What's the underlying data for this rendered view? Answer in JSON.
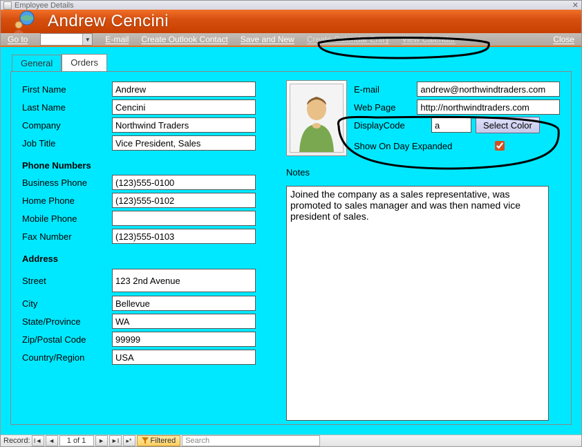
{
  "window": {
    "title": "Employee Details",
    "close_glyph": "✕"
  },
  "header": {
    "full_name": "Andrew Cencini"
  },
  "toolbar": {
    "goto_label": "Go to",
    "email": "E-mail",
    "create_outlook": "Create Outlook Contact",
    "save_new": "Save and New",
    "create_cal": "Create Calendar Entry",
    "view_cal": "View Calendar",
    "close": "Close"
  },
  "tabs": {
    "general": "General",
    "orders": "Orders"
  },
  "fields": {
    "first_name_lbl": "First Name",
    "first_name": "Andrew",
    "last_name_lbl": "Last Name",
    "last_name": "Cencini",
    "company_lbl": "Company",
    "company": "Northwind Traders",
    "job_title_lbl": "Job Title",
    "job_title": "Vice President, Sales",
    "phone_section": "Phone Numbers",
    "bus_phone_lbl": "Business Phone",
    "bus_phone": "(123)555-0100",
    "home_phone_lbl": "Home Phone",
    "home_phone": "(123)555-0102",
    "mobile_phone_lbl": "Mobile Phone",
    "mobile_phone": "",
    "fax_lbl": "Fax Number",
    "fax": "(123)555-0103",
    "address_section": "Address",
    "street_lbl": "Street",
    "street": "123 2nd Avenue",
    "city_lbl": "City",
    "city": "Bellevue",
    "state_lbl": "State/Province",
    "state": "WA",
    "zip_lbl": "Zip/Postal Code",
    "zip": "99999",
    "country_lbl": "Country/Region",
    "country": "USA"
  },
  "right": {
    "email_lbl": "E-mail",
    "email": "andrew@northwindtraders.com",
    "web_lbl": "Web Page",
    "web": "http://northwindtraders.com",
    "dc_lbl": "DisplayCode",
    "dc": "a",
    "select_color": "Select Color",
    "show_expand_lbl": "Show On Day Expanded",
    "show_expand_checked": true,
    "notes_lbl": "Notes",
    "notes": "Joined the company as a sales representative, was promoted to sales manager and was then named vice president of sales."
  },
  "recordbar": {
    "label": "Record:",
    "pos": "1 of 1",
    "filtered": "Filtered",
    "search_placeholder": "Search"
  }
}
